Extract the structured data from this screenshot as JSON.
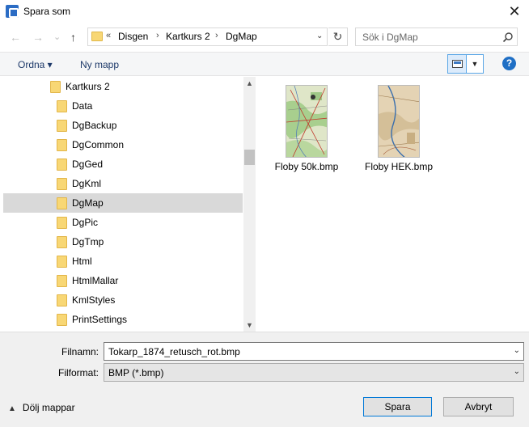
{
  "window": {
    "title": "Spara som",
    "close_symbol": "✕"
  },
  "nav": {
    "back": "←",
    "forward": "→",
    "recent": "⌄",
    "up": "↑",
    "address_prefix": "«",
    "breadcrumb": [
      "Disgen",
      "Kartkurs 2",
      "DgMap"
    ],
    "separator": "›",
    "dropdown": "⌄",
    "refresh": "↻",
    "search_placeholder": "Sök i DgMap"
  },
  "toolbar": {
    "organize_label": "Ordna ▾",
    "new_folder_label": "Ny mapp",
    "view_dropdown": "▼",
    "help_label": "?"
  },
  "tree": {
    "items": [
      {
        "label": "Kartkurs 2",
        "level": 0
      },
      {
        "label": "Data",
        "level": 1
      },
      {
        "label": "DgBackup",
        "level": 1
      },
      {
        "label": "DgCommon",
        "level": 1
      },
      {
        "label": "DgGed",
        "level": 1
      },
      {
        "label": "DgKml",
        "level": 1
      },
      {
        "label": "DgMap",
        "level": 1,
        "selected": true
      },
      {
        "label": "DgPic",
        "level": 1
      },
      {
        "label": "DgTmp",
        "level": 1
      },
      {
        "label": "Html",
        "level": 1
      },
      {
        "label": "HtmlMallar",
        "level": 1
      },
      {
        "label": "KmlStyles",
        "level": 1
      },
      {
        "label": "PrintSettings",
        "level": 1
      }
    ],
    "scroll_up": "▲",
    "scroll_down": "▼"
  },
  "files": [
    {
      "name": "Floby 50k.bmp",
      "style": "topo"
    },
    {
      "name": "Floby HEK.bmp",
      "style": "hek"
    }
  ],
  "form": {
    "filename_label": "Filnamn:",
    "filename_value": "Tokarp_1874_retusch_rot.bmp",
    "format_label": "Filformat:",
    "format_value": "BMP (*.bmp)",
    "dropdown": "⌄"
  },
  "footer": {
    "toggle_chevron": "▲",
    "toggle_label": "Dölj mappar",
    "save_label": "Spara",
    "cancel_label": "Avbryt"
  }
}
